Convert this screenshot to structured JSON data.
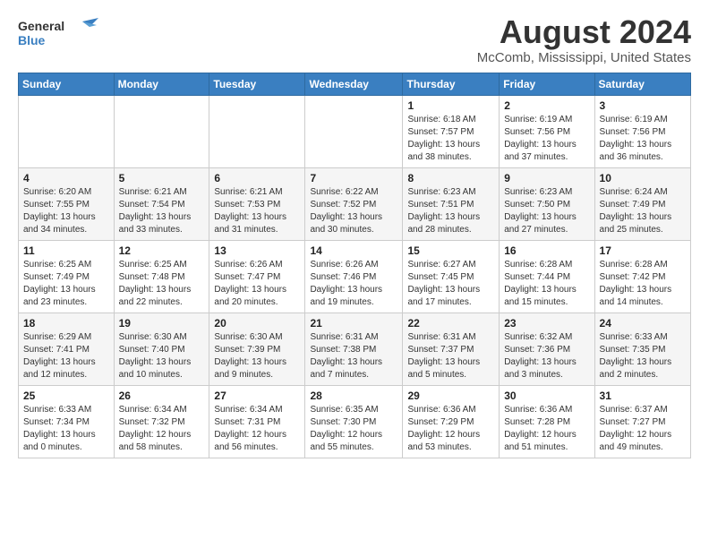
{
  "logo": {
    "line1": "General",
    "line2": "Blue"
  },
  "calendar": {
    "title": "August 2024",
    "subtitle": "McComb, Mississippi, United States"
  },
  "weekdays": [
    "Sunday",
    "Monday",
    "Tuesday",
    "Wednesday",
    "Thursday",
    "Friday",
    "Saturday"
  ],
  "weeks": [
    [
      {
        "day": "",
        "info": ""
      },
      {
        "day": "",
        "info": ""
      },
      {
        "day": "",
        "info": ""
      },
      {
        "day": "",
        "info": ""
      },
      {
        "day": "1",
        "info": "Sunrise: 6:18 AM\nSunset: 7:57 PM\nDaylight: 13 hours\nand 38 minutes."
      },
      {
        "day": "2",
        "info": "Sunrise: 6:19 AM\nSunset: 7:56 PM\nDaylight: 13 hours\nand 37 minutes."
      },
      {
        "day": "3",
        "info": "Sunrise: 6:19 AM\nSunset: 7:56 PM\nDaylight: 13 hours\nand 36 minutes."
      }
    ],
    [
      {
        "day": "4",
        "info": "Sunrise: 6:20 AM\nSunset: 7:55 PM\nDaylight: 13 hours\nand 34 minutes."
      },
      {
        "day": "5",
        "info": "Sunrise: 6:21 AM\nSunset: 7:54 PM\nDaylight: 13 hours\nand 33 minutes."
      },
      {
        "day": "6",
        "info": "Sunrise: 6:21 AM\nSunset: 7:53 PM\nDaylight: 13 hours\nand 31 minutes."
      },
      {
        "day": "7",
        "info": "Sunrise: 6:22 AM\nSunset: 7:52 PM\nDaylight: 13 hours\nand 30 minutes."
      },
      {
        "day": "8",
        "info": "Sunrise: 6:23 AM\nSunset: 7:51 PM\nDaylight: 13 hours\nand 28 minutes."
      },
      {
        "day": "9",
        "info": "Sunrise: 6:23 AM\nSunset: 7:50 PM\nDaylight: 13 hours\nand 27 minutes."
      },
      {
        "day": "10",
        "info": "Sunrise: 6:24 AM\nSunset: 7:49 PM\nDaylight: 13 hours\nand 25 minutes."
      }
    ],
    [
      {
        "day": "11",
        "info": "Sunrise: 6:25 AM\nSunset: 7:49 PM\nDaylight: 13 hours\nand 23 minutes."
      },
      {
        "day": "12",
        "info": "Sunrise: 6:25 AM\nSunset: 7:48 PM\nDaylight: 13 hours\nand 22 minutes."
      },
      {
        "day": "13",
        "info": "Sunrise: 6:26 AM\nSunset: 7:47 PM\nDaylight: 13 hours\nand 20 minutes."
      },
      {
        "day": "14",
        "info": "Sunrise: 6:26 AM\nSunset: 7:46 PM\nDaylight: 13 hours\nand 19 minutes."
      },
      {
        "day": "15",
        "info": "Sunrise: 6:27 AM\nSunset: 7:45 PM\nDaylight: 13 hours\nand 17 minutes."
      },
      {
        "day": "16",
        "info": "Sunrise: 6:28 AM\nSunset: 7:44 PM\nDaylight: 13 hours\nand 15 minutes."
      },
      {
        "day": "17",
        "info": "Sunrise: 6:28 AM\nSunset: 7:42 PM\nDaylight: 13 hours\nand 14 minutes."
      }
    ],
    [
      {
        "day": "18",
        "info": "Sunrise: 6:29 AM\nSunset: 7:41 PM\nDaylight: 13 hours\nand 12 minutes."
      },
      {
        "day": "19",
        "info": "Sunrise: 6:30 AM\nSunset: 7:40 PM\nDaylight: 13 hours\nand 10 minutes."
      },
      {
        "day": "20",
        "info": "Sunrise: 6:30 AM\nSunset: 7:39 PM\nDaylight: 13 hours\nand 9 minutes."
      },
      {
        "day": "21",
        "info": "Sunrise: 6:31 AM\nSunset: 7:38 PM\nDaylight: 13 hours\nand 7 minutes."
      },
      {
        "day": "22",
        "info": "Sunrise: 6:31 AM\nSunset: 7:37 PM\nDaylight: 13 hours\nand 5 minutes."
      },
      {
        "day": "23",
        "info": "Sunrise: 6:32 AM\nSunset: 7:36 PM\nDaylight: 13 hours\nand 3 minutes."
      },
      {
        "day": "24",
        "info": "Sunrise: 6:33 AM\nSunset: 7:35 PM\nDaylight: 13 hours\nand 2 minutes."
      }
    ],
    [
      {
        "day": "25",
        "info": "Sunrise: 6:33 AM\nSunset: 7:34 PM\nDaylight: 13 hours\nand 0 minutes."
      },
      {
        "day": "26",
        "info": "Sunrise: 6:34 AM\nSunset: 7:32 PM\nDaylight: 12 hours\nand 58 minutes."
      },
      {
        "day": "27",
        "info": "Sunrise: 6:34 AM\nSunset: 7:31 PM\nDaylight: 12 hours\nand 56 minutes."
      },
      {
        "day": "28",
        "info": "Sunrise: 6:35 AM\nSunset: 7:30 PM\nDaylight: 12 hours\nand 55 minutes."
      },
      {
        "day": "29",
        "info": "Sunrise: 6:36 AM\nSunset: 7:29 PM\nDaylight: 12 hours\nand 53 minutes."
      },
      {
        "day": "30",
        "info": "Sunrise: 6:36 AM\nSunset: 7:28 PM\nDaylight: 12 hours\nand 51 minutes."
      },
      {
        "day": "31",
        "info": "Sunrise: 6:37 AM\nSunset: 7:27 PM\nDaylight: 12 hours\nand 49 minutes."
      }
    ]
  ]
}
